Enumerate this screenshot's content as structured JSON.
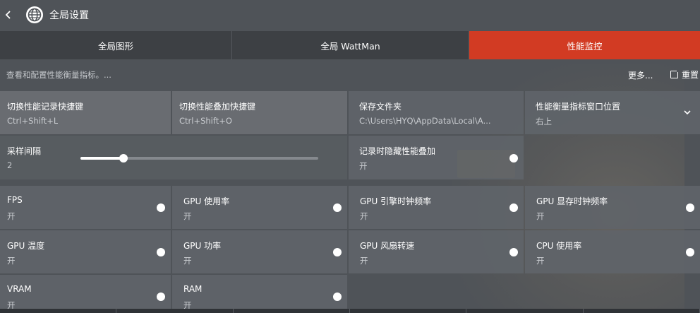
{
  "header": {
    "title": "全局设置"
  },
  "tabs": [
    {
      "label": "全局图形"
    },
    {
      "label": "全局 WattMan"
    },
    {
      "label": "性能监控"
    }
  ],
  "info": {
    "text": "查看和配置性能衡量指标。...",
    "more_label": "更多...",
    "reset_label": "重置"
  },
  "settings": {
    "record_hotkey": {
      "label": "切换性能记录快捷键",
      "value": "Ctrl+Shift+L"
    },
    "overlay_hotkey": {
      "label": "切换性能叠加快捷键",
      "value": "Ctrl+Shift+O"
    },
    "save_folder": {
      "label": "保存文件夹",
      "value": "C:\\Users\\HYQ\\AppData\\Local\\A..."
    },
    "window_position": {
      "label": "性能衡量指标窗口位置",
      "value": "右上"
    },
    "sampling_interval": {
      "label": "采样间隔",
      "value": "2",
      "slider_fraction": 0.18
    },
    "hide_overlay_while_recording": {
      "label": "记录时隐藏性能叠加",
      "value": "开"
    }
  },
  "metrics": [
    {
      "label": "FPS",
      "value": "开"
    },
    {
      "label": "GPU 使用率",
      "value": "开"
    },
    {
      "label": "GPU 引擎时钟频率",
      "value": "开"
    },
    {
      "label": "GPU 显存时钟频率",
      "value": "开"
    },
    {
      "label": "GPU 温度",
      "value": "开"
    },
    {
      "label": "GPU 功率",
      "value": "开"
    },
    {
      "label": "GPU 风扇转速",
      "value": "开"
    },
    {
      "label": "CPU 使用率",
      "value": "开"
    },
    {
      "label": "VRAM",
      "value": "开"
    },
    {
      "label": "RAM",
      "value": "开"
    }
  ],
  "colors": {
    "accent": "#d23b23",
    "tile": "#606469",
    "tab_bg": "#3d4044"
  }
}
